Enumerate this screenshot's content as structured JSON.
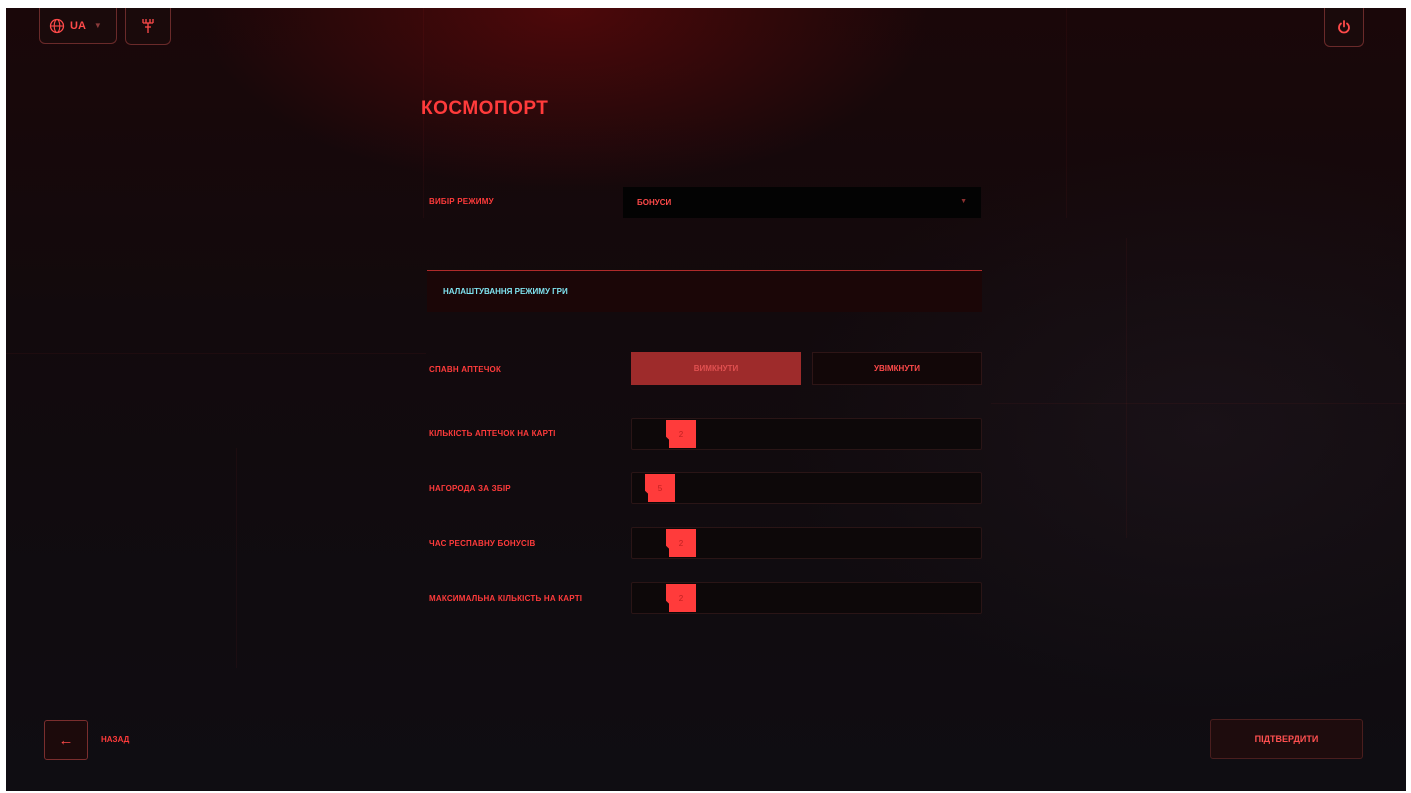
{
  "colors": {
    "accent": "#ff3b3b",
    "cyan": "#7fe3f0",
    "background": "#120a0d"
  },
  "header": {
    "language_code": "UA",
    "language_icon": "globe-icon",
    "tool_icon": "antenna-icon",
    "power_icon": "power-icon"
  },
  "page": {
    "title": "КОСМОПОРТ"
  },
  "mode": {
    "label": "ВИБІР РЕЖИМУ",
    "selected": "БОНУСИ",
    "caret_icon": "chevron-down-icon"
  },
  "settings_section": {
    "title": "НАЛАШТУВАННЯ РЕЖИМУ ГРИ"
  },
  "medkit_spawn": {
    "label": "СПАВН АПТЕЧОК",
    "options": [
      "ВИМКНУТИ",
      "УВІМКНУТИ"
    ],
    "selected": "ВИМКНУТИ"
  },
  "sliders": [
    {
      "label": "КІЛЬКІСТЬ АПТЕЧОК НА КАРТІ",
      "value": "2"
    },
    {
      "label": "НАГОРОДА ЗА ЗБІР",
      "value": "5"
    },
    {
      "label": "ЧАС РЕСПАВНУ БОНУСІВ",
      "value": "2"
    },
    {
      "label": "МАКСИМАЛЬНА КІЛЬКІСТЬ НА КАРТІ",
      "value": "2"
    }
  ],
  "footer": {
    "back_label": "НАЗАД",
    "back_icon": "arrow-left-icon",
    "confirm_label": "ПІДТВЕРДИТИ"
  }
}
